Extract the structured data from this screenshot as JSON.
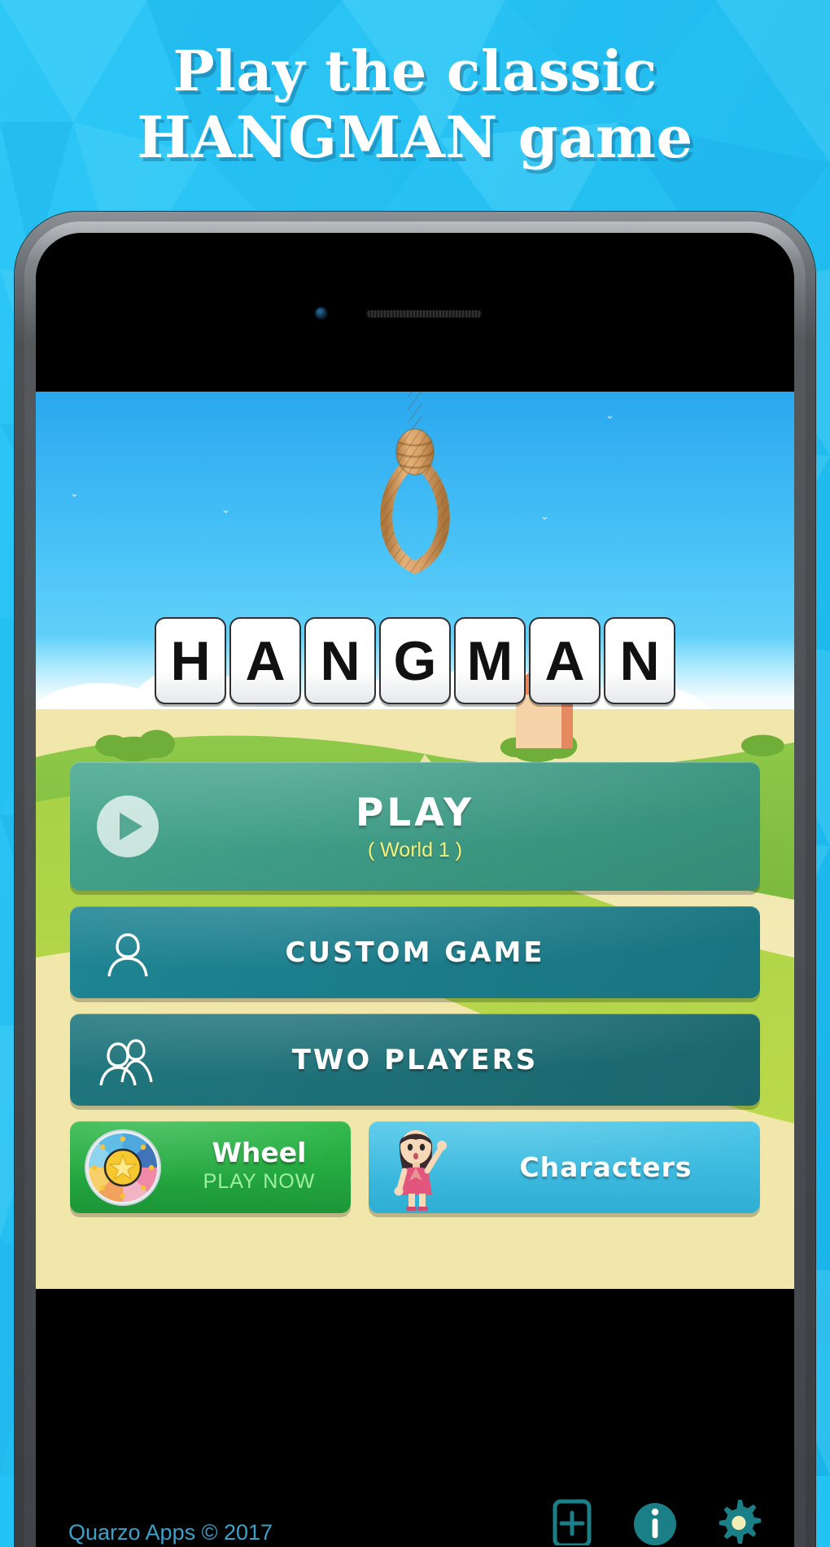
{
  "promo": {
    "line1": "Play the classic",
    "line2": "HANGMAN game",
    "bg_color": "#23c4f5",
    "text_color": "#ffffff"
  },
  "phone": {
    "bezel_color": "#4c5053",
    "screen_bg": "#000000",
    "camera_icon": "camera-icon",
    "speaker_icon": "speaker-grille-icon"
  },
  "game": {
    "title_tiles": [
      "H",
      "A",
      "N",
      "G",
      "M",
      "A",
      "N"
    ],
    "sky_top_color": "#2aa8ef",
    "sky_bottom_color": "#79e0fb",
    "grass_color": "#8dc63f",
    "rope_icon": "noose-rope-icon",
    "menu": {
      "play": {
        "label": "PLAY",
        "sub_label": "( World 1 )",
        "icon": "play-circle-icon",
        "color": "#3e9b85",
        "sub_color": "#f5f07a"
      },
      "custom_game": {
        "label": "CUSTOM GAME",
        "icon": "single-person-icon",
        "color": "#1c7d8b"
      },
      "two_players": {
        "label": "TWO PLAYERS",
        "icon": "two-people-icon",
        "color": "#1d6f76"
      },
      "wheel": {
        "label": "Wheel",
        "sub_label": "PLAY NOW",
        "icon": "prize-wheel-icon",
        "color": "#24a840",
        "sub_color": "#9ff0a2"
      },
      "characters": {
        "label": "Characters",
        "icon": "girl-character-icon",
        "color": "#3bb9de"
      }
    },
    "footer": {
      "copyright": "Quarzo Apps © 2017",
      "copyright_color": "#3aa2c9",
      "icons": [
        {
          "name": "add-box-icon"
        },
        {
          "name": "info-icon"
        },
        {
          "name": "gear-icon"
        }
      ]
    }
  }
}
